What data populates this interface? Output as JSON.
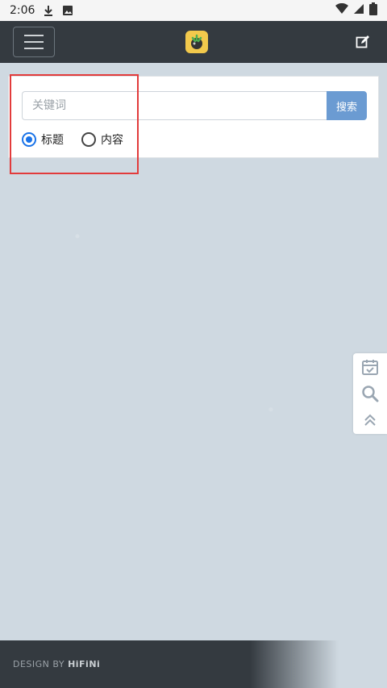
{
  "status_bar": {
    "time": "2:06"
  },
  "navbar": {
    "menu_icon": "hamburger-icon",
    "logo_icon": "app-logo-icon",
    "edit_icon": "edit-icon"
  },
  "search": {
    "placeholder": "关键词",
    "button_label": "搜索",
    "options": [
      {
        "label": "标题",
        "checked": true
      },
      {
        "label": "内容",
        "checked": false
      }
    ]
  },
  "side_tools": [
    {
      "icon": "calendar-check-icon"
    },
    {
      "icon": "search-icon"
    },
    {
      "icon": "chevron-double-up-icon"
    }
  ],
  "footer": {
    "prefix": "DESIGN BY ",
    "brand": "HiFiNi"
  },
  "colors": {
    "navbar": "#343a40",
    "search_button": "#6b9bd2",
    "highlight": "#e23b3b",
    "wallpaper": "#cfd9e1"
  }
}
